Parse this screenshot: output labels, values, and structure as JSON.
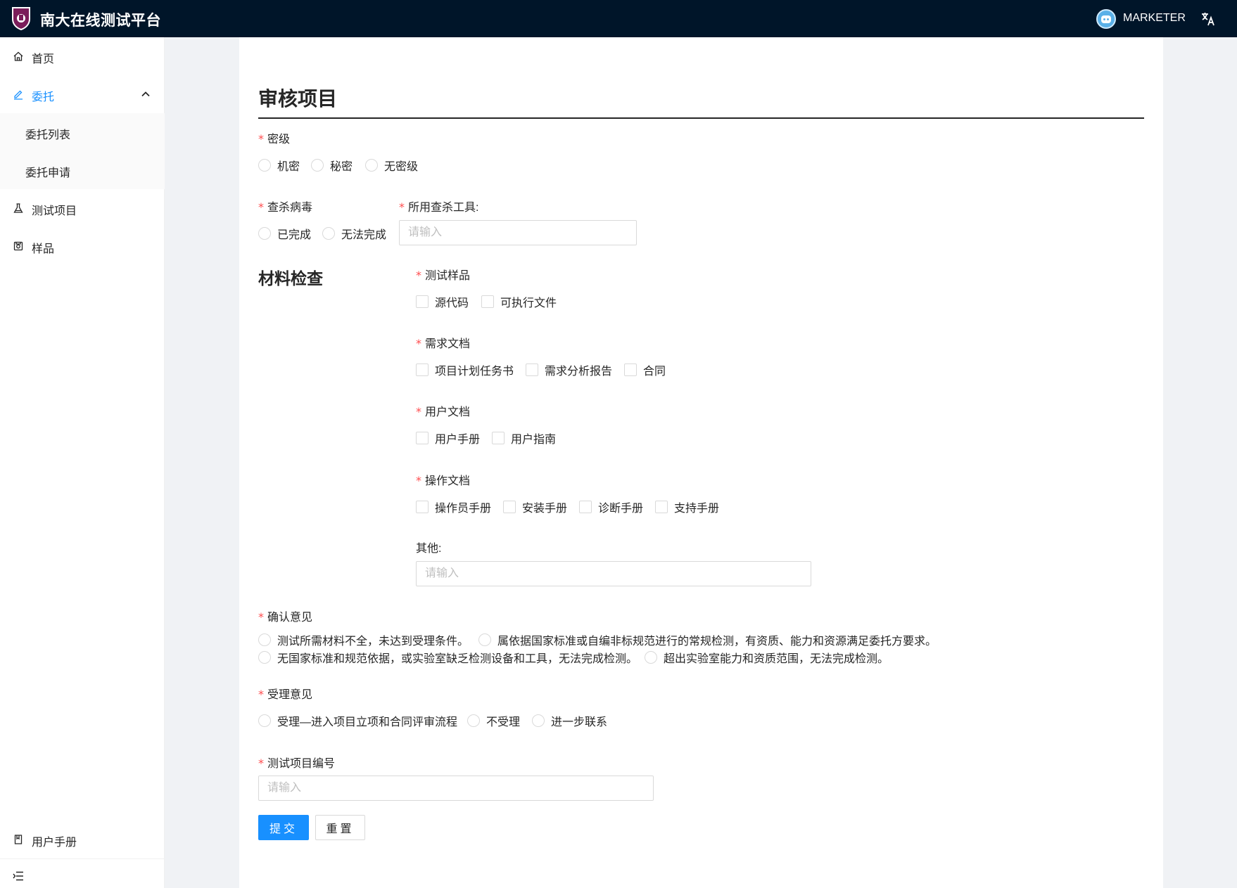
{
  "header": {
    "app_title": "南大在线测试平台",
    "username": "MARKETER",
    "lang_icon": "translate-icon"
  },
  "sidebar": {
    "items": [
      {
        "label": "首页",
        "icon": "home-icon"
      },
      {
        "label": "委托",
        "icon": "edit-icon"
      },
      {
        "label": "测试项目",
        "icon": "flask-icon"
      },
      {
        "label": "样品",
        "icon": "sample-icon"
      }
    ],
    "sub_items": [
      "委托列表",
      "委托申请"
    ],
    "footer_item": {
      "label": "用户手册",
      "icon": "book-icon"
    },
    "collapse_icon": "menu-fold-icon"
  },
  "form": {
    "title": "审核项目",
    "secret": {
      "label": "密级",
      "options": [
        "机密",
        "秘密",
        "无密级"
      ]
    },
    "virus": {
      "label": "查杀病毒",
      "options": [
        "已完成",
        "无法完成"
      ]
    },
    "tool": {
      "label": "所用查杀工具:",
      "placeholder": "请输入"
    },
    "materials": {
      "title": "材料检查",
      "sample": {
        "label": "测试样品",
        "options": [
          "源代码",
          "可执行文件"
        ]
      },
      "requirements": {
        "label": "需求文档",
        "options": [
          "项目计划任务书",
          "需求分析报告",
          "合同"
        ]
      },
      "user_docs": {
        "label": "用户文档",
        "options": [
          "用户手册",
          "用户指南"
        ]
      },
      "ops_docs": {
        "label": "操作文档",
        "options": [
          "操作员手册",
          "安装手册",
          "诊断手册",
          "支持手册"
        ]
      },
      "other": {
        "label": "其他:",
        "placeholder": "请输入"
      }
    },
    "confirm": {
      "label": "确认意见",
      "options": [
        "测试所需材料不全，未达到受理条件。",
        "属依据国家标准或自编非标规范进行的常规检测，有资质、能力和资源满足委托方要求。",
        "无国家标准和规范依据，或实验室缺乏检测设备和工具，无法完成检测。",
        "超出实验室能力和资质范围，无法完成检测。"
      ]
    },
    "accept": {
      "label": "受理意见",
      "options": [
        "受理—进入项目立项和合同评审流程",
        "不受理",
        "进一步联系"
      ]
    },
    "project_no": {
      "label": "测试项目编号",
      "placeholder": "请输入"
    },
    "submit_label": "提交",
    "reset_label": "重置"
  }
}
